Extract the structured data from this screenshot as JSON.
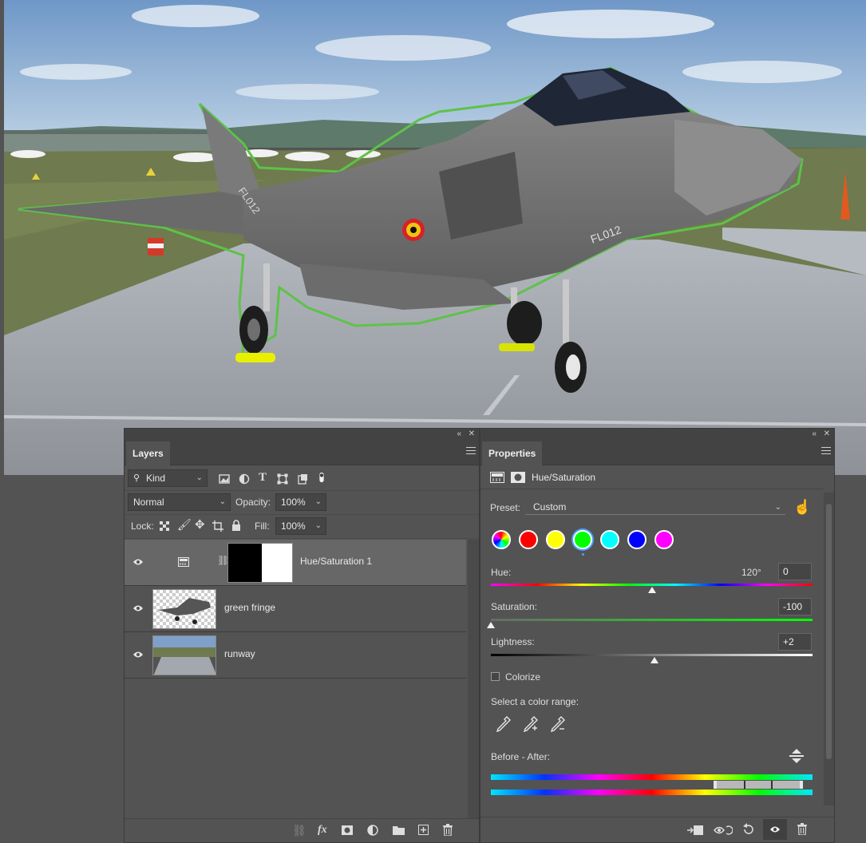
{
  "layers_panel": {
    "tab": "Layers",
    "filter_kind": "Kind",
    "blend_mode": "Normal",
    "opacity_label": "Opacity:",
    "opacity_value": "100%",
    "lock_label": "Lock:",
    "fill_label": "Fill:",
    "fill_value": "100%",
    "layers": [
      {
        "name": "Hue/Saturation 1",
        "selected": true
      },
      {
        "name": "green fringe",
        "selected": false
      },
      {
        "name": "runway",
        "selected": false
      }
    ]
  },
  "properties_panel": {
    "tab": "Properties",
    "adjustment_title": "Hue/Saturation",
    "preset_label": "Preset:",
    "preset_value": "Custom",
    "hue_label": "Hue:",
    "hue_degrees": "120°",
    "hue_value": "0",
    "saturation_label": "Saturation:",
    "saturation_value": "-100",
    "lightness_label": "Lightness:",
    "lightness_value": "+2",
    "colorize_label": "Colorize",
    "color_range_label": "Select a color range:",
    "before_after_label": "Before - After:",
    "swatches": [
      "#ff0000",
      "#ffff00",
      "#00ff00",
      "#00ffff",
      "#0000ff",
      "#ff00ff"
    ],
    "selected_swatch": "green"
  },
  "canvas": {
    "aircraft_markings": [
      "FL012"
    ]
  },
  "colors": {
    "panel_bg": "#535353",
    "panel_dark": "#434343",
    "selection_outline": "#5ec24a",
    "highlight_yellow": "#e8f000"
  }
}
